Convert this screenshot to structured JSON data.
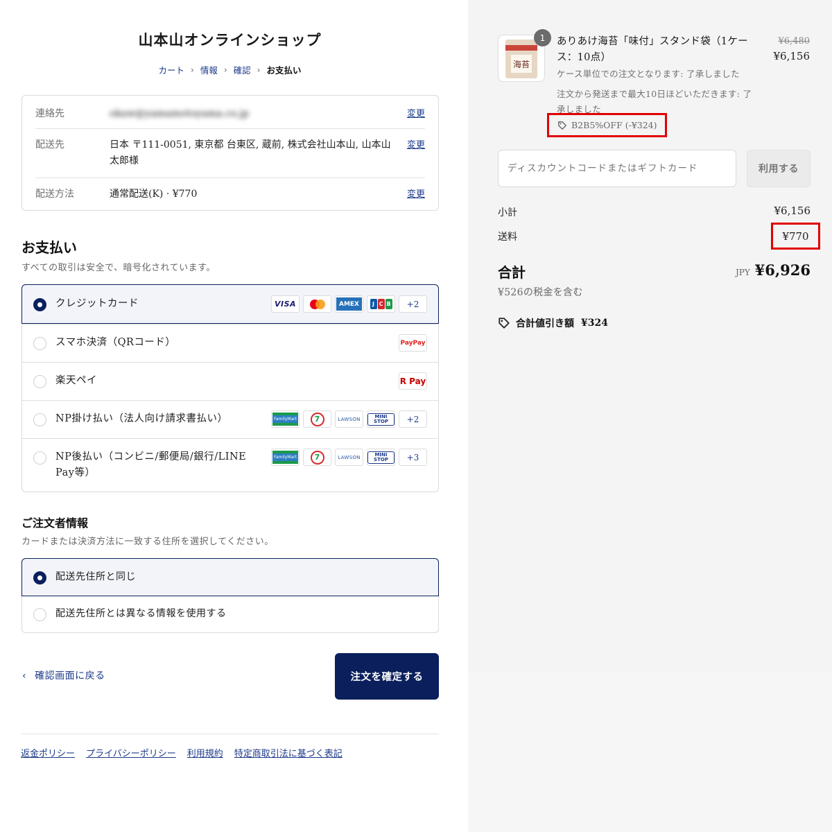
{
  "header": {
    "shop_title": "山本山オンラインショップ",
    "breadcrumb": [
      {
        "label": "カート"
      },
      {
        "label": "情報"
      },
      {
        "label": "確認"
      },
      {
        "label": "お支払い"
      }
    ]
  },
  "info": {
    "contact": {
      "label": "連絡先",
      "value": "okaw@yamamotoyama.co.jp",
      "change": "変更"
    },
    "shipping": {
      "label": "配送先",
      "value": "日本 〒111-0051, 東京都 台東区, 蔵前, 株式会社山本山, 山本山 太郎様",
      "change": "変更"
    },
    "method": {
      "label": "配送方法",
      "value": "通常配送(K) · ¥770",
      "change": "変更"
    }
  },
  "payment": {
    "title": "お支払い",
    "subtitle": "すべての取引は安全で、暗号化されています。",
    "options": [
      {
        "label": "クレジットカード",
        "selected": true,
        "more": "+2"
      },
      {
        "label": "スマホ決済（QRコード）",
        "selected": false
      },
      {
        "label": "楽天ペイ",
        "selected": false
      },
      {
        "label": "NP掛け払い（法人向け請求書払い）",
        "selected": false,
        "more": "+2"
      },
      {
        "label": "NP後払い（コンビニ/郵便局/銀行/LINE Pay等）",
        "selected": false,
        "more": "+3"
      }
    ],
    "badges": {
      "visa": "VISA",
      "amex": "AMEX",
      "jcb": [
        "J",
        "C",
        "B"
      ],
      "paypay": "PayPay",
      "rpay": "R Pay",
      "familymart": "FamilyMart",
      "seven": "7",
      "lawson": "LAWSON",
      "ministop": "MINI STOP"
    }
  },
  "billing": {
    "title": "ご注文者情報",
    "subtitle": "カードまたは決済方法に一致する住所を選択してください。",
    "options": [
      {
        "label": "配送先住所と同じ",
        "selected": true
      },
      {
        "label": "配送先住所とは異なる情報を使用する",
        "selected": false
      }
    ]
  },
  "actions": {
    "back_label": "確認画面に戻る",
    "confirm_label": "注文を確定する"
  },
  "footer": {
    "links": [
      "返金ポリシー",
      "プライバシーポリシー",
      "利用規約",
      "特定商取引法に基づく表記"
    ]
  },
  "summary": {
    "product": {
      "thumb_label": "海苔",
      "quantity": "1",
      "name": "ありあけ海苔「味付」スタンド袋（1ケース：10点）",
      "price_old": "¥6,480",
      "price_new": "¥6,156",
      "notes": [
        "ケース単位での注文となります: 了承しました",
        "注文から発送まで最大10日ほどいただきます: 了承しました"
      ],
      "discount": "B2B5%OFF (-¥324)"
    },
    "discount_input": {
      "placeholder": "ディスカウントコードまたはギフトカード",
      "apply_label": "利用する"
    },
    "subtotal": {
      "label": "小計",
      "value": "¥6,156"
    },
    "shipping": {
      "label": "送料",
      "value": "¥770"
    },
    "total": {
      "label": "合計",
      "currency": "JPY",
      "value": "¥6,926"
    },
    "tax_note": "¥526の税金を含む",
    "savings": {
      "label": "合計値引き額",
      "value": "¥324"
    }
  },
  "colors": {
    "primary": "#0a1f5c",
    "link": "#1d3a8a",
    "highlight": "#e10000",
    "panel_bg": "#f4f4f4"
  }
}
